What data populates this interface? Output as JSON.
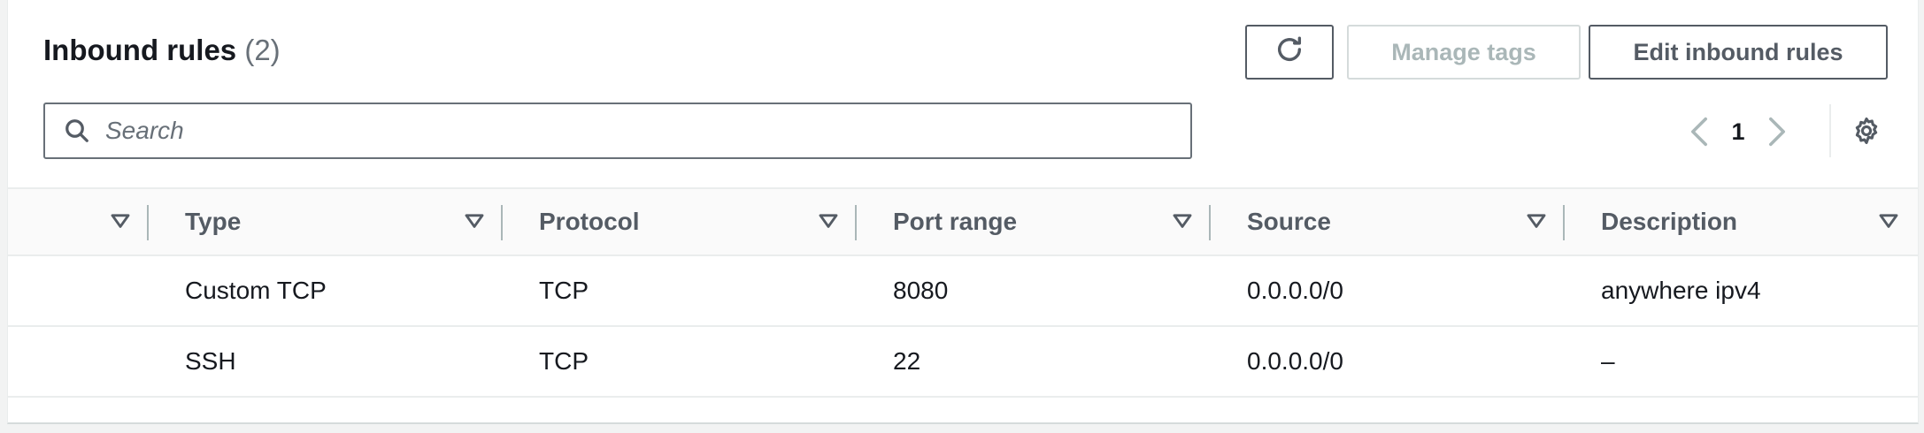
{
  "header": {
    "title": "Inbound rules",
    "count": "(2)"
  },
  "toolbar": {
    "refresh_icon": "refresh-icon",
    "manage_tags_label": "Manage tags",
    "edit_inbound_label": "Edit inbound rules"
  },
  "search": {
    "placeholder": "Search",
    "value": ""
  },
  "pagination": {
    "current_page": "1"
  },
  "table": {
    "columns": [
      "",
      "Type",
      "Protocol",
      "Port range",
      "Source",
      "Description"
    ],
    "rows": [
      {
        "type": "Custom TCP",
        "protocol": "TCP",
        "port_range": "8080",
        "source": "0.0.0.0/0",
        "description": "anywhere ipv4"
      },
      {
        "type": "SSH",
        "protocol": "TCP",
        "port_range": "22",
        "source": "0.0.0.0/0",
        "description": "–"
      }
    ]
  },
  "colors": {
    "primary_text": "#16191f",
    "secondary_text": "#545b64",
    "disabled_text": "#aab7b8",
    "border": "#eaeded"
  }
}
